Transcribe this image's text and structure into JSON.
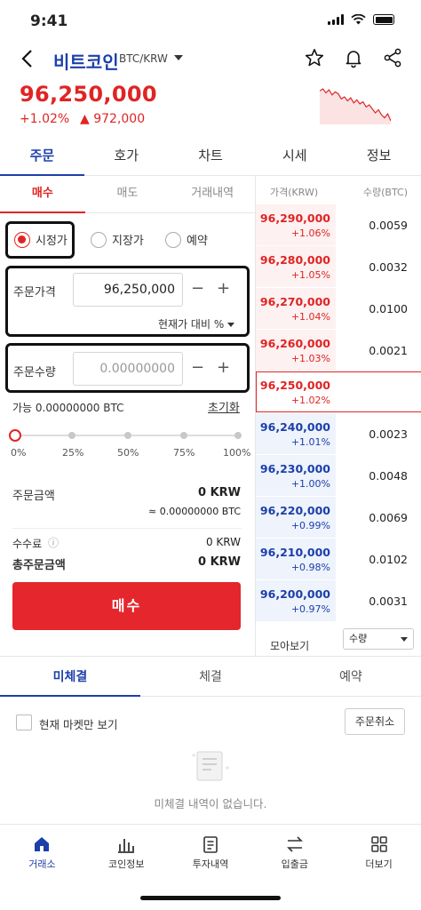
{
  "status": {
    "time": "9:41"
  },
  "header": {
    "coin_name": "비트코인",
    "pair": "BTC/KRW"
  },
  "ticker": {
    "price": "96,250,000",
    "change_rate": "+1.02%",
    "change_amount": "▲ 972,000",
    "sparkline": [
      48,
      46,
      50,
      47,
      52,
      49,
      51,
      56,
      54,
      58,
      55,
      60,
      57,
      61,
      59,
      64,
      62,
      66,
      70,
      67,
      72,
      75,
      71,
      78
    ]
  },
  "main_tabs": [
    "주문",
    "호가",
    "차트",
    "시세",
    "정보"
  ],
  "order_tabs": [
    "매수",
    "매도",
    "거래내역"
  ],
  "order_types": [
    "시정가",
    "지장가",
    "예약"
  ],
  "order_form": {
    "price_label": "주문가격",
    "price_value": "96,250,000",
    "price_ref": "현재가 대비 %",
    "qty_label": "주문수량",
    "qty_placeholder": "0.00000000",
    "minus": "−",
    "plus": "+",
    "available": "가능  0.00000000 BTC",
    "reset": "초기화",
    "slider_labels": [
      "0%",
      "25%",
      "50%",
      "75%",
      "100%"
    ],
    "slider_value": 0,
    "order_amount_label": "주문금액",
    "order_amount": "0 KRW",
    "order_amount_btc": "≈  0.00000000 BTC",
    "fee_label": "수수료",
    "fee_info": "ⓘ",
    "fee": "0 KRW",
    "total_label": "총주문금액",
    "total": "0 KRW",
    "buy_button": "매수"
  },
  "orderbook": {
    "head_price": "가격(KRW)",
    "head_qty": "수량(BTC)",
    "asks": [
      {
        "price": "96,290,000",
        "rate": "+1.06%",
        "qty": "0.0059"
      },
      {
        "price": "96,280,000",
        "rate": "+1.05%",
        "qty": "0.0032"
      },
      {
        "price": "96,270,000",
        "rate": "+1.04%",
        "qty": "0.0100"
      },
      {
        "price": "96,260,000",
        "rate": "+1.03%",
        "qty": "0.0021"
      },
      {
        "price": "96,250,000",
        "rate": "+1.02%",
        "qty": ""
      }
    ],
    "bids": [
      {
        "price": "96,240,000",
        "rate": "+1.01%",
        "qty": "0.0023"
      },
      {
        "price": "96,230,000",
        "rate": "+1.00%",
        "qty": "0.0048"
      },
      {
        "price": "96,220,000",
        "rate": "+0.99%",
        "qty": "0.0069"
      },
      {
        "price": "96,210,000",
        "rate": "+0.98%",
        "qty": "0.0102"
      },
      {
        "price": "96,200,000",
        "rate": "+0.97%",
        "qty": "0.0031"
      }
    ],
    "view_label": "모아보기",
    "view_option": "수량"
  },
  "orders_tabs": [
    "미체결",
    "체결",
    "예약"
  ],
  "orders": {
    "current_market_only": "현재 마켓만 보기",
    "cancel_all": "주문취소",
    "empty": "미체결 내역이 없습니다."
  },
  "bottom_nav": [
    "거래소",
    "코인정보",
    "투자내역",
    "입출금",
    "더보기"
  ],
  "colors": {
    "accent": "#1c3faa",
    "up": "#e02424",
    "down": "#1c3faa"
  }
}
